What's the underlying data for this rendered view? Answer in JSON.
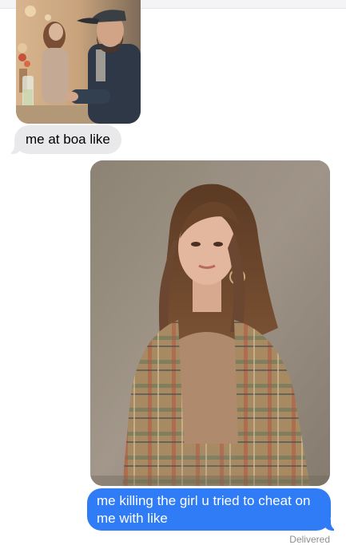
{
  "conversation": {
    "messages": [
      {
        "direction": "received",
        "type": "photo",
        "icon": "photo-man-in-cap-at-restaurant"
      },
      {
        "direction": "received",
        "type": "text",
        "text": "me at boa like"
      },
      {
        "direction": "sent",
        "type": "photo",
        "icon": "photo-woman-in-plaid-jacket"
      },
      {
        "direction": "sent",
        "type": "text",
        "text": "me killing the girl u tried to cheat on me with like"
      }
    ],
    "status": "Delivered"
  },
  "colors": {
    "received_bubble": "#e9e9eb",
    "sent_bubble": "#2f7cf6",
    "status_text": "#8e8e93"
  }
}
